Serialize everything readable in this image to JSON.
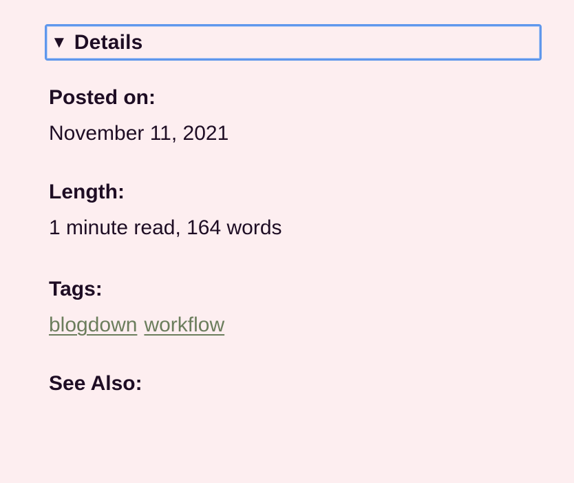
{
  "details": {
    "summary_marker": "▼",
    "summary_label": "Details"
  },
  "posted": {
    "label": "Posted on:",
    "value": "November 11, 2021"
  },
  "length": {
    "label": "Length:",
    "value": "1 minute read, 164 words"
  },
  "tags": {
    "label": "Tags:",
    "items": [
      "blogdown",
      "workflow"
    ]
  },
  "see_also": {
    "label": "See Also:"
  },
  "colors": {
    "background": "#fdeef0",
    "text": "#1e0d24",
    "link": "#6b7d5c",
    "focus_ring": "#5f97ec"
  }
}
